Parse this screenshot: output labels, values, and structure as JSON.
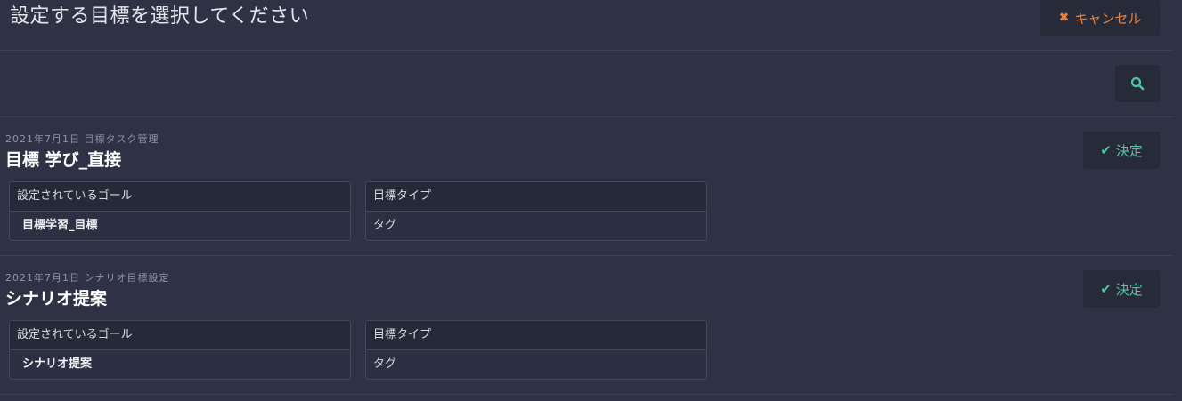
{
  "header": {
    "title": "設定する目標を選択してください",
    "cancel_label": "キャンセル",
    "cancel_icon": "times-icon"
  },
  "toolbar": {
    "search_icon": "search-icon"
  },
  "accent_colors": {
    "cancel": "#e8823d",
    "confirm": "#4fc6a3"
  },
  "goals": [
    {
      "id": "2021年7月1日 目標タスク管理",
      "name": "目標 学び_直接",
      "decide_label": "決定",
      "decide_icon": "check-icon",
      "goal_header": "設定されているゴール",
      "goal_value": "目標学習_目標",
      "type_header": "目標タイプ",
      "type_value": "タグ"
    },
    {
      "id": "2021年7月1日 シナリオ目標設定",
      "name": "シナリオ提案",
      "decide_label": "決定",
      "decide_icon": "check-icon",
      "goal_header": "設定されているゴール",
      "goal_value": "シナリオ提案",
      "type_header": "目標タイプ",
      "type_value": "タグ"
    }
  ]
}
